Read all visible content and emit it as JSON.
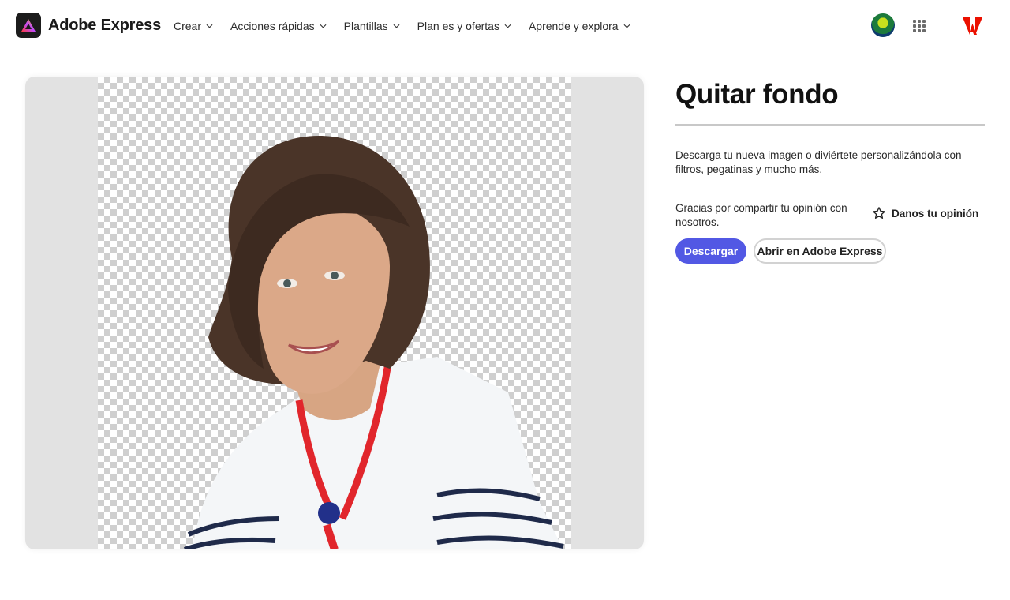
{
  "brand": {
    "name": "Adobe Express",
    "logo_icon": "adobe-express-logo-icon"
  },
  "nav": {
    "items": [
      {
        "label": "Crear"
      },
      {
        "label": "Acciones rápidas"
      },
      {
        "label": "Plantillas"
      },
      {
        "label": "Plan es y ofertas"
      },
      {
        "label": "Aprende y explora"
      }
    ]
  },
  "header_right": {
    "avatar": "user-avatar",
    "apps_icon": "app-grid-icon",
    "adobe_icon": "adobe-logo-icon"
  },
  "preview": {
    "background": "transparent-checkerboard"
  },
  "panel": {
    "title": "Quitar fondo",
    "description": "Descarga tu nueva imagen o diviértete personalizándola con filtros, pegatinas y mucho más.",
    "thanks": "Gracias por compartir tu opinión con nosotros.",
    "feedback_label": "Danos tu opinión",
    "download_label": "Descargar",
    "open_label": "Abrir en Adobe Express"
  },
  "colors": {
    "primary_button": "#5258e4",
    "adobe_red": "#eb1000"
  }
}
